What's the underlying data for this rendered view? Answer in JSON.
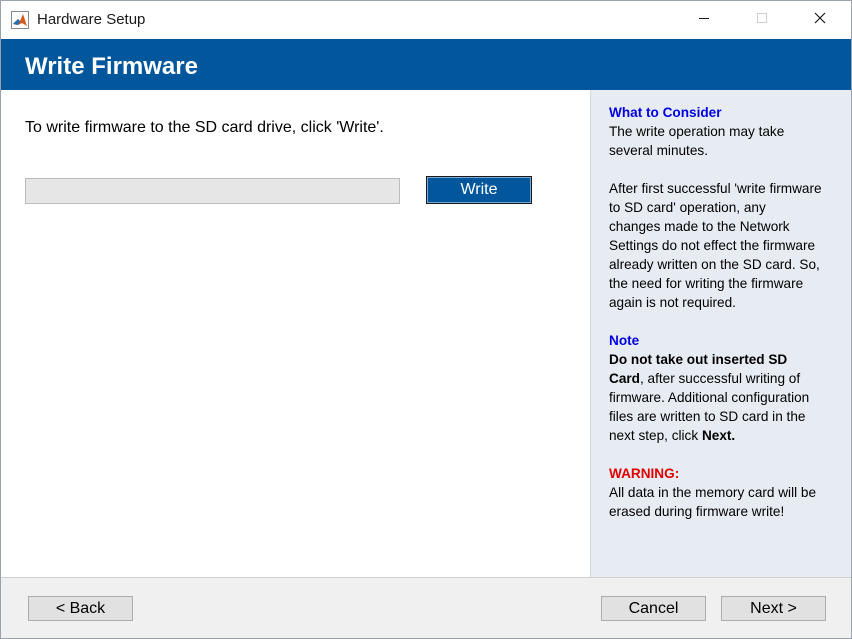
{
  "window": {
    "title": "Hardware Setup",
    "app_icon": "matlab-logo-icon",
    "controls": {
      "minimize": "minimize-icon",
      "maximize": "maximize-icon",
      "close": "close-icon"
    }
  },
  "header": {
    "title": "Write Firmware",
    "background_color": "#02569b"
  },
  "main": {
    "instruction": "To write firmware to the SD card drive, click 'Write'.",
    "progress": {
      "value": 0
    },
    "write_button": "Write"
  },
  "side_panel": {
    "consider_heading": "What to Consider",
    "consider_line1": "The write operation may take",
    "consider_line2": "several minutes.",
    "after_line1": "After first successful 'write firmware",
    "after_line2": "to SD card' operation, any",
    "after_line3": "changes made to the Network",
    "after_line4": "Settings do not effect the firmware",
    "after_line5": "already written on the SD card. So,",
    "after_line6": "the need for writing the firmware",
    "after_line7": "again is not required.",
    "note_heading": "Note",
    "note_bold1": "Do not take out inserted SD",
    "note_bold2": "Card",
    "note_line2_rest": ", after successful writing of",
    "note_line3": "firmware. Additional configuration",
    "note_line4": "files are written to SD card in the",
    "note_line5_start": "next step, click ",
    "note_line5_bold": "Next.",
    "warning_heading": "WARNING:",
    "warning_line1": "All data in the memory card will be",
    "warning_line2": "erased during firmware write!",
    "heading_color": "#0000e0",
    "warning_color": "#e00000"
  },
  "footer": {
    "back": "< Back",
    "cancel": "Cancel",
    "next": "Next >"
  }
}
